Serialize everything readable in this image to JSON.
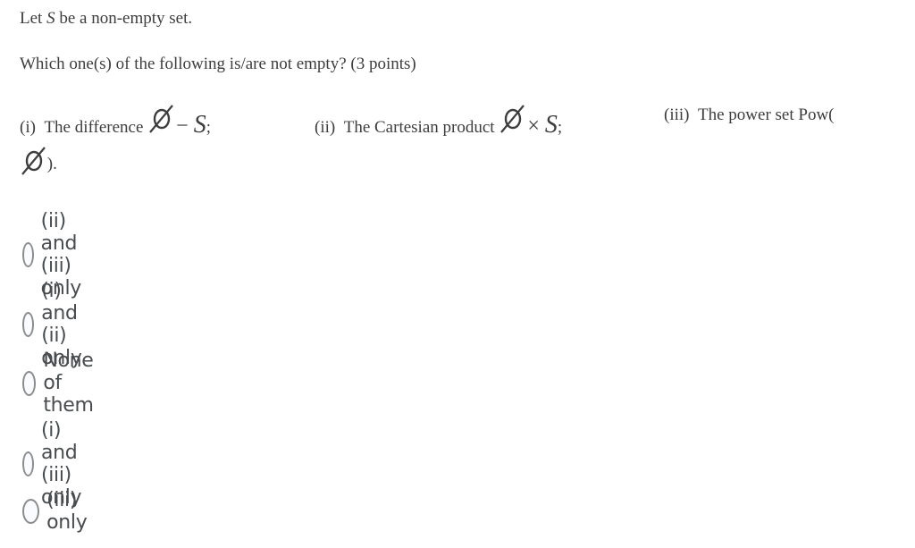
{
  "question": {
    "intro_prefix": "Let ",
    "intro_var": "S",
    "intro_suffix": " be a non-empty set.",
    "prompt": "Which one(s) of the following is/are not empty? (3 points)",
    "items": [
      {
        "label": "(i)",
        "text": "The difference",
        "op": "−",
        "var": "S",
        "end": ";"
      },
      {
        "label": "(ii)",
        "text": "The Cartesian product",
        "op": "×",
        "var": "S",
        "end": ";"
      },
      {
        "label": "(iii)",
        "text": "The power set Pow(",
        "end": ")."
      }
    ]
  },
  "options": [
    {
      "label": "(ii) and (iii) only",
      "selected": false
    },
    {
      "label": "(i) and (ii) only",
      "selected": false
    },
    {
      "label": "None of them",
      "selected": false
    },
    {
      "label": "(i) and (iii) only",
      "selected": false
    },
    {
      "label": "(iii) only",
      "selected": false
    }
  ]
}
